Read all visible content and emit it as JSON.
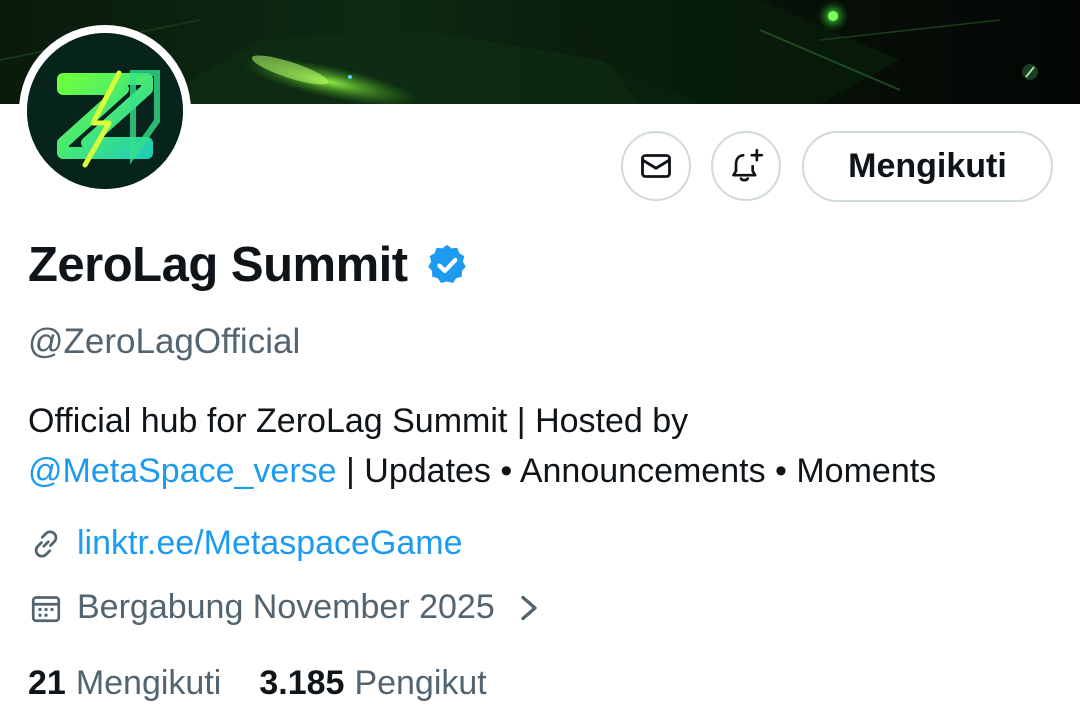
{
  "profile": {
    "display_name": "ZeroLag Summit",
    "handle": "@ZeroLagOfficial",
    "verified": true,
    "verified_color": "#1d9bf0"
  },
  "actions": {
    "message_icon": "envelope-icon",
    "notify_icon": "bell-plus-icon",
    "follow_label": "Mengikuti"
  },
  "bio": {
    "line1": "Official hub for ZeroLag Summit | Hosted by",
    "mention": "@MetaSpace_verse",
    "line2_rest": " | Updates • Announcements • Moments"
  },
  "meta": {
    "link_icon": "link-icon",
    "link_text": "linktr.ee/MetaspaceGame",
    "calendar_icon": "calendar-icon",
    "joined_text": "Bergabung November 2025",
    "chevron_icon": "chevron-right-icon"
  },
  "stats": {
    "following_count": "21",
    "following_label": "Mengikuti",
    "followers_count": "3.185",
    "followers_label": "Pengikut"
  },
  "colors": {
    "text_primary": "#0f1419",
    "text_secondary": "#536471",
    "accent_blue": "#1d9bf0",
    "border": "#cfd9de",
    "brand_green": "#7cff3a"
  }
}
